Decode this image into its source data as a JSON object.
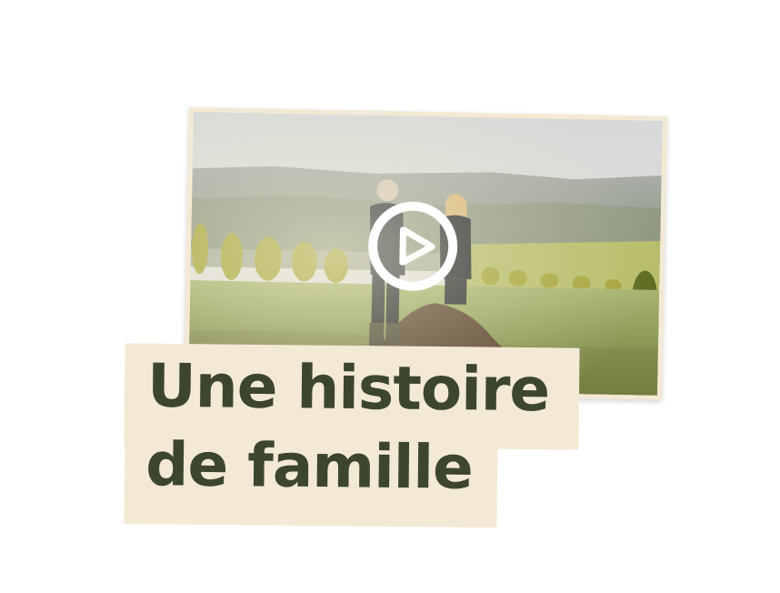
{
  "video": {
    "thumbnail_description": "",
    "play_icon": "play-icon",
    "colors": {
      "frame": "#f3e9d4",
      "play_button": "#ffffff"
    }
  },
  "title": {
    "line1": "Une histoire",
    "line2": "de famille",
    "color": "#3c4530",
    "background": "#f3e9d4"
  }
}
